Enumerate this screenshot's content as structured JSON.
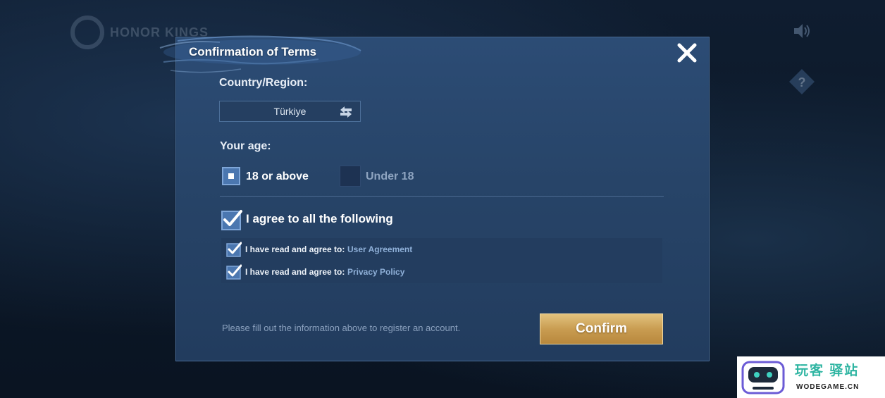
{
  "background": {
    "logo_text": "HONOR KINGS"
  },
  "dialog": {
    "title": "Confirmation of Terms",
    "country_label": "Country/Region:",
    "country_value": "Türkiye",
    "age_label": "Your age:",
    "age_options": [
      {
        "label": "18 or above",
        "checked": true
      },
      {
        "label": "Under 18",
        "checked": false
      }
    ],
    "agree_all_label": "I agree to all the following",
    "terms": [
      {
        "prefix": "I have read and agree to:",
        "link": "User Agreement",
        "checked": true
      },
      {
        "prefix": "I have read and agree to:",
        "link": "Privacy Policy",
        "checked": true
      }
    ],
    "hint": "Please fill out the information above to register an account.",
    "confirm_label": "Confirm"
  },
  "watermark": {
    "cn_text": "玩客 驿站",
    "en_text": "WODEGAME.CN"
  },
  "colors": {
    "dialog_bg": "#274468",
    "gold_button": "#c99d52",
    "link": "#8fb0d8",
    "checkbox": "#4b77b0",
    "watermark_green": "#2fb5a2"
  },
  "icons": [
    "close-icon",
    "swap-arrows-icon",
    "checkmark-icon",
    "sound-icon",
    "help-icon",
    "robot-logo-icon"
  ]
}
